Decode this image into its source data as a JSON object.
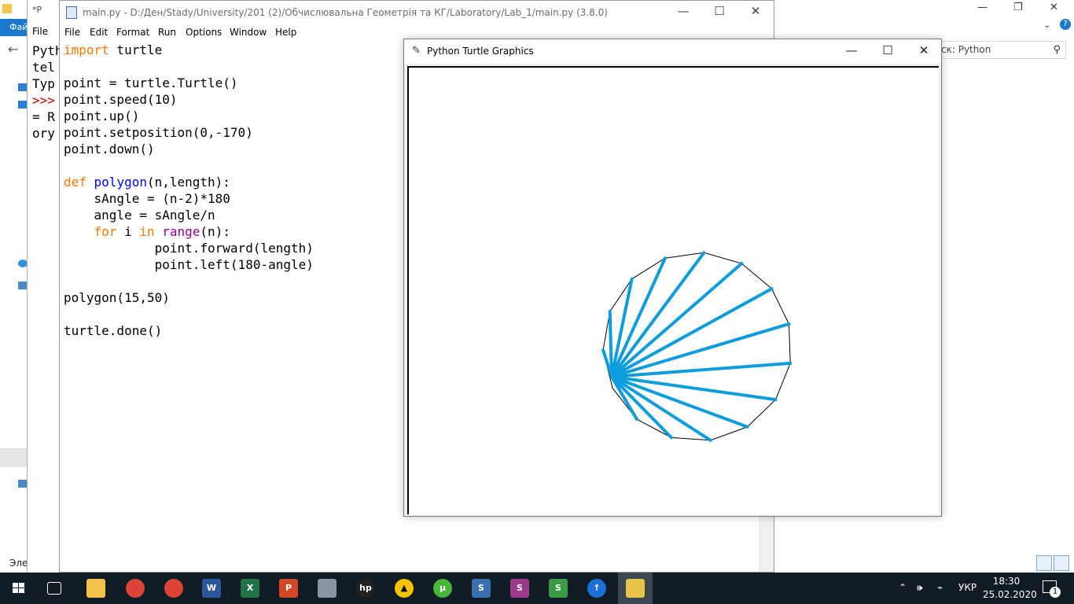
{
  "explorer": {
    "ribbon_label": "Фай",
    "search_placeholder": "ск: Python",
    "status_label": "Эле",
    "win_minimize": "—",
    "win_maximize": "❐",
    "win_close": "✕"
  },
  "shell": {
    "title": "*P",
    "menu_file": "File",
    "lines": [
      "Pyth",
      "tel",
      "Typ",
      ">>>",
      "= R",
      "ory"
    ]
  },
  "editor": {
    "title": "main.py - D:/Ден/Stady/University/201 (2)/Обчислювальна Геометрія та КГ/Laboratory/Lab_1/main.py (3.8.0)",
    "menu": [
      "File",
      "Edit",
      "Format",
      "Run",
      "Options",
      "Window",
      "Help"
    ],
    "code": {
      "l1_kw": "import",
      "l1_rest": " turtle",
      "l3": "point = turtle.Turtle()",
      "l4": "point.speed(10)",
      "l5": "point.up()",
      "l6": "point.setposition(0,-170)",
      "l7": "point.down()",
      "l9_kw": "def",
      "l9_name": " polygon",
      "l9_rest": "(n,length):",
      "l10": "    sAngle = (n-2)*180",
      "l11": "    angle = sAngle/n",
      "l12_indent": "    ",
      "l12_for": "for",
      "l12_i": " i ",
      "l12_in": "in",
      "l12_sp": " ",
      "l12_range": "range",
      "l12_rest": "(n):",
      "l13": "            point.forward(length)",
      "l14": "            point.left(180-angle)",
      "l16": "polygon(15,50)",
      "l18": "turtle.done()"
    }
  },
  "turtle_window": {
    "title": "Python Turtle Graphics",
    "stroke_color": "#0d9ddb",
    "edge_color": "#000000",
    "polygon_sides": 15,
    "side_length": 50
  },
  "taskbar": {
    "language": "УКР",
    "time": "18:30",
    "date": "25.02.2020",
    "notification_count": "1",
    "apps": [
      "file-explorer",
      "chrome",
      "chrome-profile",
      "word",
      "excel",
      "powerpoint",
      "disk-utility",
      "hp",
      "arch",
      "utorrent",
      "sql-1",
      "sql-2",
      "sql-3",
      "upload",
      "python-idle"
    ]
  }
}
